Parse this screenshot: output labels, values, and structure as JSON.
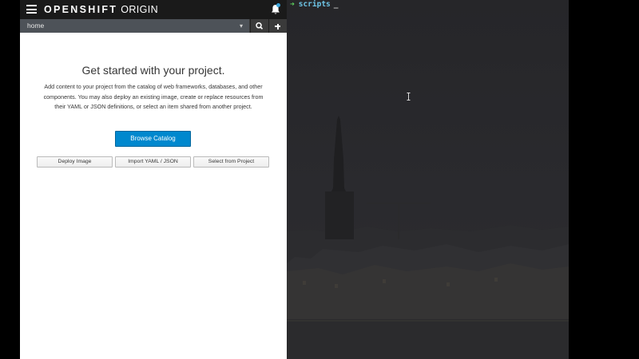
{
  "app": {
    "brand_bold": "OPENSHIFT",
    "brand_light": "ORIGIN"
  },
  "nav": {
    "project_name": "home",
    "icons": {
      "menu": "hamburger-menu-icon",
      "notifications": "bell-icon",
      "dropdown": "chevron-down-icon",
      "search": "search-icon",
      "add": "plus-icon"
    }
  },
  "empty_state": {
    "heading": "Get started with your project.",
    "description": "Add content to your project from the catalog of web frameworks, databases, and other components. You may also deploy an existing image, create or replace resources from their YAML or JSON definitions, or select an item shared from another project.",
    "primary_button": "Browse Catalog",
    "secondary_buttons": [
      "Deploy Image",
      "Import YAML / JSON",
      "Select from Project"
    ]
  },
  "terminal": {
    "prompt_arrow": "➜",
    "directory": "scripts",
    "cursor": "_"
  },
  "colors": {
    "topbar": "#1a1a1a",
    "project_bar": "#4d5258",
    "primary": "#0088ce",
    "notification_badge": "#39a5dc",
    "prompt_arrow": "#5fd75f",
    "prompt_dir": "#6ec6e8",
    "terminal_bg": "#26272b"
  }
}
